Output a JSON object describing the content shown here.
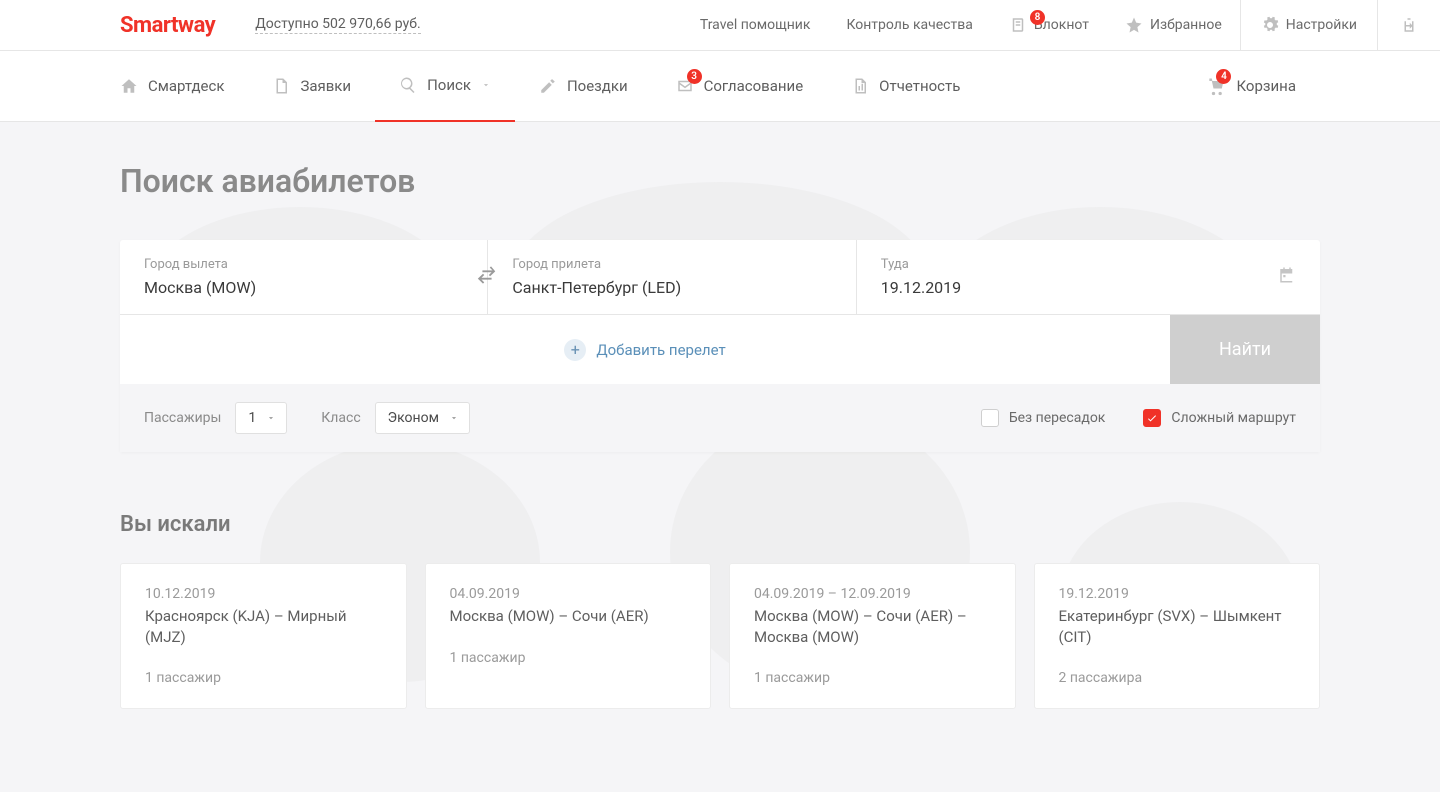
{
  "brand": "Smartway",
  "balance": "Доступно 502 970,66 руб.",
  "topnav": {
    "travel_helper": "Travel помощник",
    "quality": "Контроль качества",
    "notebook": "Блокнот",
    "notebook_badge": "8",
    "favorites": "Избранное",
    "settings": "Настройки"
  },
  "tabs": {
    "smartdesk": "Смартдеск",
    "requests": "Заявки",
    "search": "Поиск",
    "trips": "Поездки",
    "approval": "Согласование",
    "approval_badge": "3",
    "reports": "Отчетность",
    "cart": "Корзина",
    "cart_badge": "4"
  },
  "page_title": "Поиск авиабилетов",
  "form": {
    "from_label": "Город вылета",
    "from_value": "Москва (MOW)",
    "to_label": "Город прилета",
    "to_value": "Санкт-Петербург (LED)",
    "date_label": "Туда",
    "date_value": "19.12.2019",
    "add_flight": "Добавить перелет",
    "search_btn": "Найти",
    "passengers_label": "Пассажиры",
    "passengers_value": "1",
    "class_label": "Класс",
    "class_value": "Эконом",
    "no_transfer": "Без пересадок",
    "complex_route": "Сложный маршрут"
  },
  "history_title": "Вы искали",
  "history": [
    {
      "date": "10.12.2019",
      "route": "Красноярск (KJA) – Мирный (MJZ)",
      "pax": "1 пассажир"
    },
    {
      "date": "04.09.2019",
      "route": "Москва (MOW) – Сочи (AER)",
      "pax": "1 пассажир"
    },
    {
      "date": "04.09.2019 – 12.09.2019",
      "route": "Москва (MOW) – Сочи (AER) – Москва (MOW)",
      "pax": "1 пассажир"
    },
    {
      "date": "19.12.2019",
      "route": "Екатеринбург (SVX) – Шымкент (CIT)",
      "pax": "2 пассажира"
    }
  ]
}
